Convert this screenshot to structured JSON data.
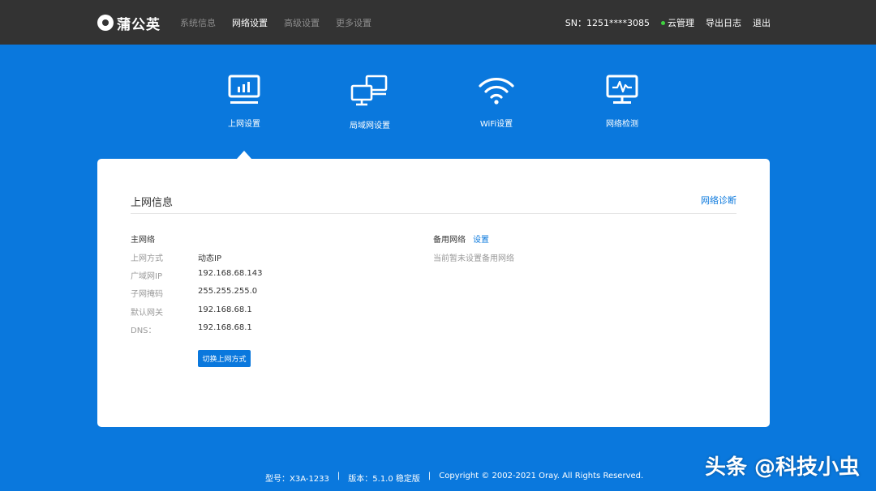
{
  "header": {
    "brand": "蒲公英",
    "nav": [
      {
        "label": "系统信息",
        "active": false
      },
      {
        "label": "网络设置",
        "active": true
      },
      {
        "label": "高级设置",
        "active": false
      },
      {
        "label": "更多设置",
        "active": false
      }
    ],
    "sn": "SN：1251****3085",
    "cloud_manage": "云管理",
    "export_log": "导出日志",
    "logout": "退出"
  },
  "categories": [
    {
      "label": "上网设置",
      "icon": "monitor-chart-icon"
    },
    {
      "label": "局域网设置",
      "icon": "lan-monitors-icon"
    },
    {
      "label": "WiFi设置",
      "icon": "wifi-icon"
    },
    {
      "label": "网络检测",
      "icon": "monitor-pulse-icon"
    }
  ],
  "panel": {
    "title": "上网信息",
    "diagnose_link": "网络诊断",
    "primary": {
      "title": "主网络",
      "rows": [
        {
          "label": "上网方式",
          "value": "动态IP"
        },
        {
          "label": "广域网IP",
          "value": "192.168.68.143"
        },
        {
          "label": "子网掩码",
          "value": "255.255.255.0"
        },
        {
          "label": "默认网关",
          "value": "192.168.68.1"
        },
        {
          "label": "DNS：",
          "value": "192.168.68.1"
        }
      ],
      "switch_button": "切换上网方式"
    },
    "backup": {
      "title": "备用网络",
      "set_link": "设置",
      "status": "当前暂未设置备用网络"
    }
  },
  "footer": {
    "model": "型号：X3A-1233",
    "sep1": "|",
    "version": "版本：5.1.0 稳定版",
    "sep2": "|",
    "copyright": "Copyright © 2002-2021 Oray. All Rights Reserved."
  },
  "watermark": "头条 @科技小虫",
  "colors": {
    "accent": "#0a78dd",
    "topbar": "#333333",
    "online": "#3fd23f"
  }
}
